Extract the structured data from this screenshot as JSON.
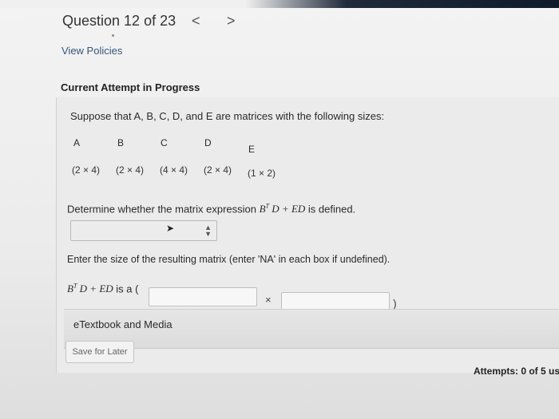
{
  "header": {
    "question_label": "Question 12 of 23",
    "prev_glyph": "<",
    "next_glyph": ">",
    "view_policies": "View Policies"
  },
  "attempt": {
    "title": "Current Attempt in Progress"
  },
  "problem": {
    "prompt": "Suppose that A, B, C, D, and E are matrices with the following sizes:",
    "matrices": [
      {
        "name": "A",
        "size": "(2 × 4)"
      },
      {
        "name": "B",
        "size": "(2 × 4)"
      },
      {
        "name": "C",
        "size": "(4 × 4)"
      },
      {
        "name": "D",
        "size": "(2 × 4)"
      },
      {
        "name": "E",
        "size": "(1 × 2)"
      }
    ],
    "question1_prefix": "Determine whether the matrix expression",
    "expr_B": "B",
    "expr_T": "T",
    "expr_rest": "D + ED",
    "question1_suffix": "is defined.",
    "question2": "Enter the size of the resulting matrix (enter 'NA' in each box if undefined).",
    "answer_prefix": "is a (",
    "times_glyph": "×",
    "close_paren": ")",
    "rows_value": "",
    "cols_value": ""
  },
  "footer": {
    "etextbook_label": "eTextbook and Media",
    "save_label": "Save for Later",
    "attempts_label": "Attempts: 0 of 5 us"
  },
  "icons": {
    "select_arrows": "updown-arrows-icon",
    "cursor": "mouse-cursor-icon"
  }
}
